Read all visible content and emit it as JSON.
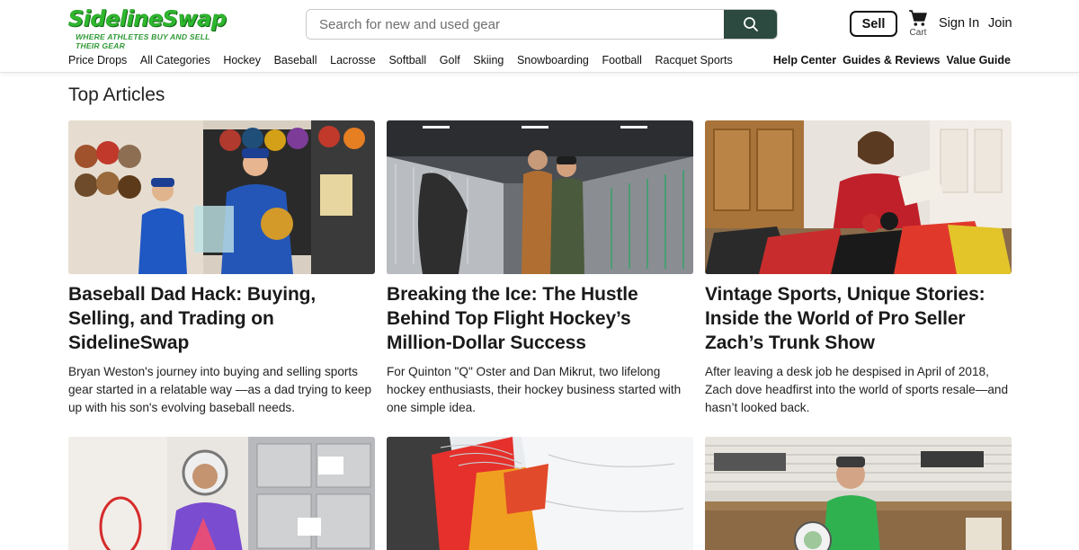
{
  "brand": {
    "logo_text": "SidelineSwap",
    "tagline": "WHERE ATHLETES BUY AND SELL THEIR GEAR",
    "primary_color": "#2eb82e",
    "button_color": "#2c4a3f"
  },
  "search": {
    "placeholder": "Search for new and used gear",
    "icon": "search-icon"
  },
  "header_actions": {
    "sell_label": "Sell",
    "cart_label": "Cart",
    "cart_icon": "shopping-cart-icon",
    "signin_label": "Sign In",
    "join_label": "Join"
  },
  "nav": {
    "categories": [
      "Price Drops",
      "All Categories",
      "Hockey",
      "Baseball",
      "Lacrosse",
      "Softball",
      "Golf",
      "Skiing",
      "Snowboarding",
      "Football",
      "Racquet Sports"
    ],
    "right_links": [
      "Help Center",
      "Guides & Reviews",
      "Value Guide"
    ]
  },
  "main": {
    "section_title": "Top Articles",
    "articles": [
      {
        "title": "Baseball Dad Hack: Buying, Selling, and Trading on SidelineSwap",
        "description": "Bryan Weston's journey into buying and selling sports gear started in a relatable way —as a dad trying to keep up with his son's evolving baseball needs.",
        "image": "dad-and-son-with-baseball-gloves-photo"
      },
      {
        "title": "Breaking the Ice: The Hustle Behind Top Flight Hockey’s Million-Dollar Success",
        "description": "For Quinton \"Q\" Oster and Dan Mikrut, two lifelong hockey enthusiasts, their hockey business started with one simple idea.",
        "image": "two-men-in-hockey-stick-warehouse-photo"
      },
      {
        "title": "Vintage Sports, Unique Stories: Inside the World of Pro Seller Zach’s Trunk Show",
        "description": "After leaving a desk job he despised in April of 2018, Zach dove headfirst into the world of sports resale—and hasn’t looked back.",
        "image": "seller-with-vintage-jerseys-photo"
      },
      {
        "title": "",
        "description": "",
        "image": "lacrosse-player-in-helmet-photo"
      },
      {
        "title": "",
        "description": "",
        "image": "jerseys-on-hangers-photo"
      },
      {
        "title": "",
        "description": "",
        "image": "man-in-workshop-with-goalie-mask-photo"
      }
    ]
  }
}
